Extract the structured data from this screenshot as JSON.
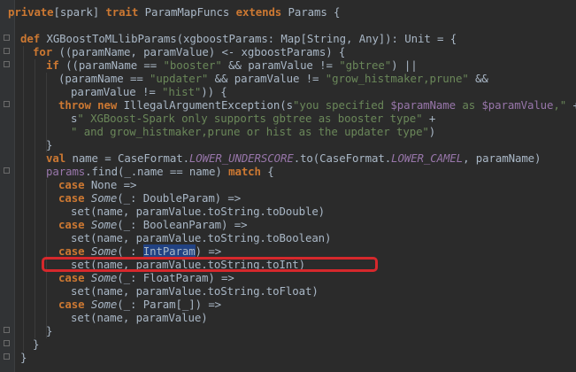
{
  "editor": {
    "language": "scala",
    "theme": "darcula",
    "colors": {
      "background": "#2b2b2b",
      "keyword": "#cc7832",
      "string": "#6a8759",
      "plain": "#a9b7c6",
      "field": "#9876aa",
      "selection": "#214283",
      "annotation_box": "#d6282c"
    },
    "selected_token": "IntParam",
    "annotated_line": "set(name, paramValue.toString.toInt)"
  },
  "lines": [
    [
      [
        "kw",
        "private"
      ],
      [
        "p",
        "[spark] "
      ],
      [
        "kw",
        "trait"
      ],
      [
        "p",
        " ParamMapFuncs "
      ],
      [
        "kw",
        "extends"
      ],
      [
        "p",
        " Params {"
      ]
    ],
    [
      [
        "p",
        ""
      ]
    ],
    [
      [
        "kw",
        "def"
      ],
      [
        "p",
        " XGBoostToMLlibParams(xgboostParams: Map[String, Any]): Unit = {"
      ]
    ],
    [
      [
        "kw",
        "for"
      ],
      [
        "p",
        " ((paramName, paramValue) <- xgboostParams) {"
      ]
    ],
    [
      [
        "kw",
        "if"
      ],
      [
        "p",
        " ((paramName == "
      ],
      [
        "str",
        "\"booster\""
      ],
      [
        "p",
        " && paramValue != "
      ],
      [
        "str",
        "\"gbtree\""
      ],
      [
        "p",
        ") ||"
      ]
    ],
    [
      [
        "p",
        "(paramName == "
      ],
      [
        "str",
        "\"updater\""
      ],
      [
        "p",
        " && paramValue != "
      ],
      [
        "str",
        "\"grow_histmaker,prune\""
      ],
      [
        "p",
        " &&"
      ]
    ],
    [
      [
        "p",
        "paramValue != "
      ],
      [
        "str",
        "\"hist\""
      ],
      [
        "p",
        ")) {"
      ]
    ],
    [
      [
        "kw",
        "throw new"
      ],
      [
        "p",
        " IllegalArgumentException(s"
      ],
      [
        "str",
        "\"you specified "
      ],
      [
        "var",
        "$paramName"
      ],
      [
        "str",
        " as "
      ],
      [
        "var",
        "$paramValue"
      ],
      [
        "str",
        ",\""
      ],
      [
        "p",
        " +"
      ]
    ],
    [
      [
        "p",
        "s"
      ],
      [
        "str",
        "\" XGBoost-Spark only supports gbtree as booster type\""
      ],
      [
        "p",
        " +"
      ]
    ],
    [
      [
        "str",
        "\" and grow_histmaker,prune or hist as the updater type\""
      ],
      [
        "p",
        ")"
      ]
    ],
    [
      [
        "p",
        "}"
      ]
    ],
    [
      [
        "kw",
        "val"
      ],
      [
        "p",
        " name = CaseFormat."
      ],
      [
        "fld",
        "LOWER_UNDERSCORE"
      ],
      [
        "p",
        ".to(CaseFormat."
      ],
      [
        "fld",
        "LOWER_CAMEL"
      ],
      [
        "p",
        ", paramName)"
      ]
    ],
    [
      [
        "var",
        "params"
      ],
      [
        "p",
        ".find(_.name == name) "
      ],
      [
        "kw",
        "match"
      ],
      [
        "p",
        " {"
      ]
    ],
    [
      [
        "kw",
        "case"
      ],
      [
        "p",
        " None =>"
      ]
    ],
    [
      [
        "kw",
        "case"
      ],
      [
        "p",
        " "
      ],
      [
        "it",
        "Some"
      ],
      [
        "p",
        "(_: DoubleParam) =>"
      ]
    ],
    [
      [
        "p",
        "set(name, paramValue.toString.toDouble)"
      ]
    ],
    [
      [
        "kw",
        "case"
      ],
      [
        "p",
        " "
      ],
      [
        "it",
        "Some"
      ],
      [
        "p",
        "(_: BooleanParam) =>"
      ]
    ],
    [
      [
        "p",
        "set(name, paramValue.toString.toBoolean)"
      ]
    ],
    [
      [
        "kw",
        "case"
      ],
      [
        "p",
        " "
      ],
      [
        "it",
        "Some"
      ],
      [
        "p",
        "(_: "
      ],
      [
        "sel",
        "IntParam"
      ],
      [
        "p",
        ") =>"
      ]
    ],
    [
      [
        "p",
        "set(name, paramValue.toString.toInt)"
      ]
    ],
    [
      [
        "kw",
        "case"
      ],
      [
        "p",
        " "
      ],
      [
        "it",
        "Some"
      ],
      [
        "p",
        "(_: FloatParam) =>"
      ]
    ],
    [
      [
        "p",
        "set(name, paramValue.toString.toFloat)"
      ]
    ],
    [
      [
        "kw",
        "case"
      ],
      [
        "p",
        " "
      ],
      [
        "it",
        "Some"
      ],
      [
        "p",
        "(_: Param[_]) =>"
      ]
    ],
    [
      [
        "p",
        "set(name, paramValue)"
      ]
    ],
    [
      [
        "p",
        "}"
      ]
    ],
    [
      [
        "p",
        "}"
      ]
    ],
    [
      [
        "p",
        "}"
      ]
    ]
  ]
}
